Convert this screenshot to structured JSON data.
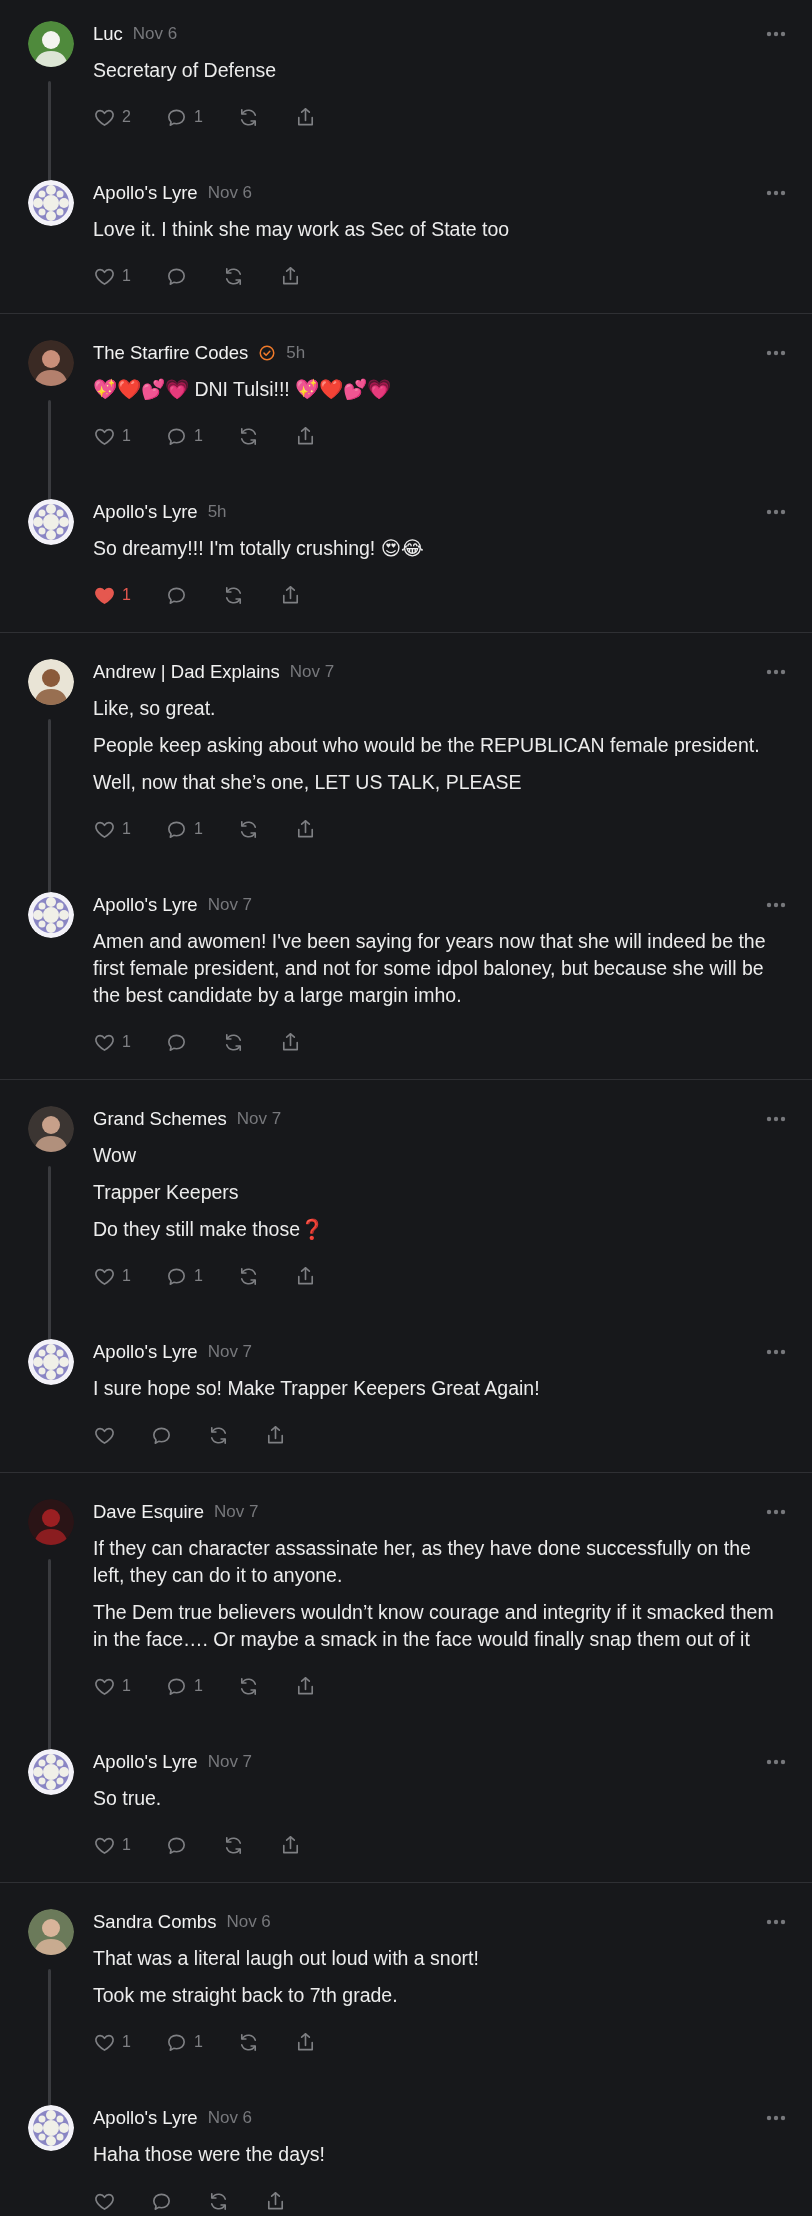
{
  "threads": [
    {
      "comments": [
        {
          "author": "Luc",
          "date": "Nov 6",
          "paragraphs": [
            "Secretary of Defense"
          ],
          "liked": false,
          "likes": "2",
          "replies": "1"
        },
        {
          "author": "Apollo's Lyre",
          "date": "Nov 6",
          "paragraphs": [
            "Love it. I think she may work as Sec of State too"
          ],
          "liked": false,
          "likes": "1"
        }
      ]
    },
    {
      "comments": [
        {
          "author": "The Starfire Codes",
          "verified": true,
          "date": "5h",
          "paragraphs": [
            "💖❤️💕💗 DNI Tulsi!!! 💖❤️💕💗"
          ],
          "liked": false,
          "likes": "1",
          "replies": "1"
        },
        {
          "author": "Apollo's Lyre",
          "date": "5h",
          "paragraphs": [
            "So dreamy!!! I'm totally crushing! 😍😂"
          ],
          "liked": true,
          "likes": "1"
        }
      ]
    },
    {
      "comments": [
        {
          "author": "Andrew | Dad Explains",
          "date": "Nov 7",
          "paragraphs": [
            "Like, so great.",
            "People keep asking about who would be the REPUBLICAN female president.",
            "Well, now that she’s one, LET US TALK, PLEASE"
          ],
          "liked": false,
          "likes": "1",
          "replies": "1"
        },
        {
          "author": "Apollo's Lyre",
          "date": "Nov 7",
          "paragraphs": [
            "Amen and awomen! I've been saying for years now that she will indeed be the first female president, and not for some idpol baloney, but because she will be the best candidate by a large margin imho."
          ],
          "liked": false,
          "likes": "1"
        }
      ]
    },
    {
      "comments": [
        {
          "author": "Grand Schemes",
          "date": "Nov 7",
          "paragraphs": [
            "Wow",
            "Trapper Keepers",
            "Do they still make those❓"
          ],
          "liked": false,
          "likes": "1",
          "replies": "1"
        },
        {
          "author": "Apollo's Lyre",
          "date": "Nov 7",
          "paragraphs": [
            "I sure hope so! Make Trapper Keepers Great Again!"
          ],
          "liked": false
        }
      ]
    },
    {
      "comments": [
        {
          "author": "Dave Esquire",
          "date": "Nov 7",
          "paragraphs": [
            "If they can character assassinate her, as they have done successfully on the left, they can do it to anyone.",
            "The Dem true believers wouldn’t know courage and integrity if it smacked them in the face…. Or maybe a smack in the face would finally snap them out of it"
          ],
          "liked": false,
          "likes": "1",
          "replies": "1"
        },
        {
          "author": "Apollo's Lyre",
          "date": "Nov 7",
          "paragraphs": [
            "So true."
          ],
          "liked": false,
          "likes": "1"
        }
      ]
    },
    {
      "comments": [
        {
          "author": "Sandra Combs",
          "date": "Nov 6",
          "paragraphs": [
            "That was a literal laugh out loud with a snort!",
            "Took me straight back to 7th grade."
          ],
          "liked": false,
          "likes": "1",
          "replies": "1"
        },
        {
          "author": "Apollo's Lyre",
          "date": "Nov 6",
          "paragraphs": [
            "Haha those were the days!"
          ],
          "liked": false
        }
      ]
    }
  ]
}
